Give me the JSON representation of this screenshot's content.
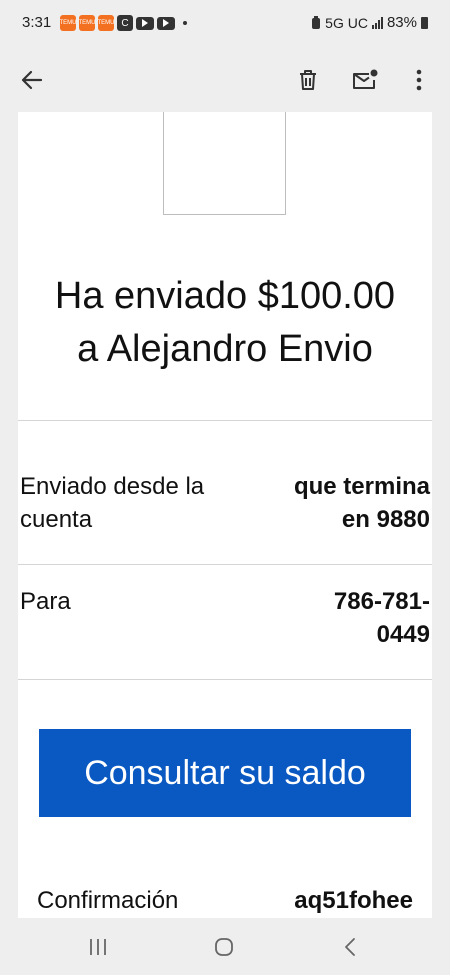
{
  "status_bar": {
    "time": "3:31",
    "notification_icons": [
      "temu-icon",
      "temu-icon",
      "temu-icon",
      "c-app-icon",
      "youtube-icon",
      "youtube-icon"
    ],
    "network": "5G UC",
    "battery": "83%"
  },
  "app_bar": {
    "back_icon": "arrow-left-icon",
    "delete_icon": "trash-icon",
    "unread_icon": "mail-unread-icon",
    "more_icon": "more-vertical-icon"
  },
  "email": {
    "headline_line1": "Ha enviado $100.00",
    "headline_line2": "a Alejandro Envio",
    "rows": [
      {
        "label_line1": "Enviado desde la",
        "label_line2": "cuenta",
        "value_line1": "que termina",
        "value_line2": "en 9880"
      },
      {
        "label_line1": "Para",
        "label_line2": "",
        "value_line1": "786-781-",
        "value_line2": "0449"
      }
    ],
    "cta_label": "Consultar su saldo",
    "confirmation_label": "Confirmación",
    "confirmation_value": "aq51fohee"
  },
  "colors": {
    "accent": "#0a58c2",
    "background": "#eeeeee",
    "card": "#ffffff"
  }
}
